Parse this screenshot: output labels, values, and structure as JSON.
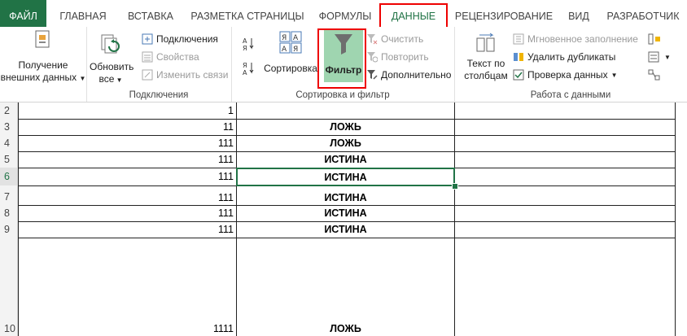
{
  "tabs": [
    {
      "label": "ФАЙЛ"
    },
    {
      "label": "ГЛАВНАЯ"
    },
    {
      "label": "ВСТАВКА"
    },
    {
      "label": "РАЗМЕТКА СТРАНИЦЫ"
    },
    {
      "label": "ФОРМУЛЫ"
    },
    {
      "label": "ДАННЫЕ"
    },
    {
      "label": "РЕЦЕНЗИРОВАНИЕ"
    },
    {
      "label": "ВИД"
    },
    {
      "label": "РАЗРАБОТЧИК"
    }
  ],
  "ribbon": {
    "external": {
      "line1": "Получение",
      "line2": "внешних данных"
    },
    "connections": {
      "refresh_line1": "Обновить",
      "refresh_line2": "все",
      "connections": "Подключения",
      "properties": "Свойства",
      "edit_links": "Изменить связи",
      "group_label": "Подключения"
    },
    "sort_filter": {
      "sort": "Сортировка",
      "filter": "Фильтр",
      "clear": "Очистить",
      "reapply": "Повторить",
      "advanced": "Дополнительно",
      "group_label": "Сортировка и фильтр"
    },
    "data_tools": {
      "text_to_cols_line1": "Текст по",
      "text_to_cols_line2": "столбцам",
      "flash_fill": "Мгновенное заполнение",
      "remove_dup": "Удалить дубликаты",
      "validation": "Проверка данных",
      "group_label": "Работа с данными"
    }
  },
  "grid": {
    "rows": [
      {
        "num": "2",
        "a": "1",
        "b": ""
      },
      {
        "num": "3",
        "a": "11",
        "b": "ЛОЖЬ"
      },
      {
        "num": "4",
        "a": "111",
        "b": "ЛОЖЬ"
      },
      {
        "num": "5",
        "a": "111",
        "b": "ИСТИНА"
      },
      {
        "num": "6",
        "a": "111",
        "b": "ИСТИНА"
      },
      {
        "num": "7",
        "a": "111",
        "b": "ИСТИНА"
      },
      {
        "num": "8",
        "a": "111",
        "b": "ИСТИНА"
      },
      {
        "num": "9",
        "a": "111",
        "b": "ИСТИНА"
      },
      {
        "num": "10",
        "a": "1111",
        "b": "ЛОЖЬ"
      }
    ]
  },
  "colors": {
    "file_tab": "#217346",
    "highlight": "#e00000",
    "filter_active": "#9fd5b0",
    "selection": "#217346"
  }
}
